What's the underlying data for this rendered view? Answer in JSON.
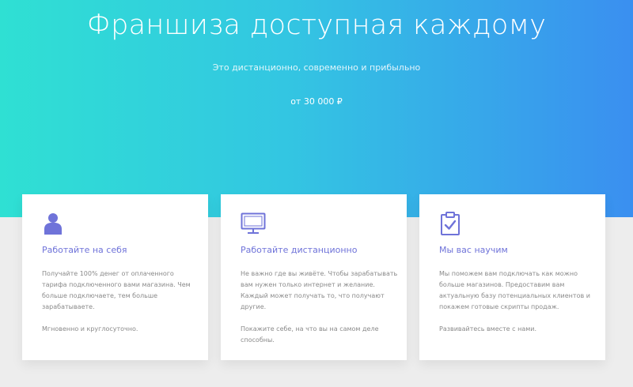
{
  "hero": {
    "title": "Франшиза доступная каждому",
    "subtitle": "Это дистанционно, современно и прибыльно",
    "price": "от 30 000 ₽"
  },
  "colors": {
    "gradient_start": "#2fe0d3",
    "gradient_end": "#3a8ff0",
    "accent": "#6f73d9",
    "page_background": "#ededed"
  },
  "cards": [
    {
      "icon": "person-icon",
      "title": "Работайте на себя",
      "paragraphs": [
        "Получайте 100% денег от оплаченного тарифа подключенного вами магазина. Чем больше подключаете, тем больше зарабатываете.",
        "Мгновенно и круглосуточно."
      ]
    },
    {
      "icon": "monitor-icon",
      "title": "Работайте дистанционно",
      "paragraphs": [
        "Не важно где вы живёте. Чтобы зарабатывать вам нужен только интернет и желание. Каждый может получать то, что получают другие.",
        "Покажите себе, на что вы на самом деле способны."
      ]
    },
    {
      "icon": "clipboard-check-icon",
      "title": "Мы вас научим",
      "paragraphs": [
        "Мы поможем вам подключать как можно больше магазинов. Предоставим вам актуальную базу потенциальных клиентов и покажем готовые скрипты продаж.",
        "Развивайтесь вместе с нами."
      ]
    }
  ]
}
